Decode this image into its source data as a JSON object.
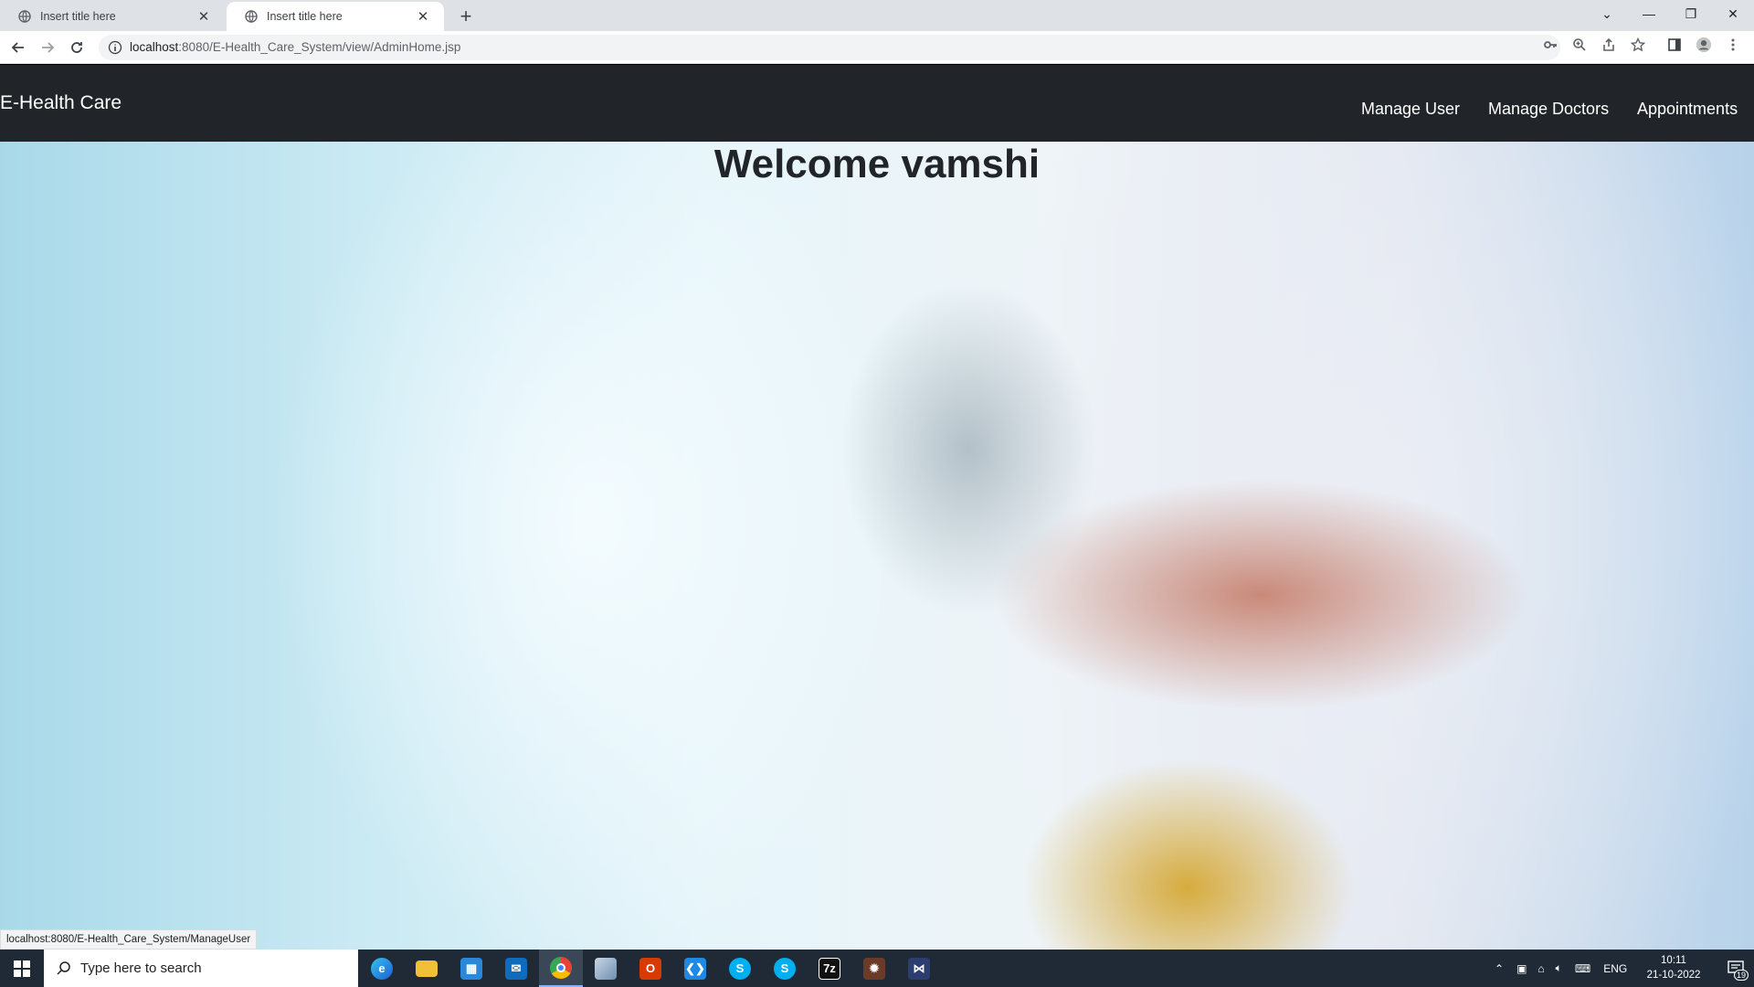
{
  "browser": {
    "tabs": [
      {
        "title": "Insert title here",
        "active": false
      },
      {
        "title": "Insert title here",
        "active": true
      }
    ],
    "url_host": "localhost",
    "url_path": ":8080/E-Health_Care_System/view/AdminHome.jsp",
    "status_url": "localhost:8080/E-Health_Care_System/ManageUser"
  },
  "navbar": {
    "brand": "E-Health Care",
    "links": [
      "Manage User",
      "Manage Doctors",
      "Appointments"
    ]
  },
  "main": {
    "welcome": "Welcome vamshi"
  },
  "taskbar": {
    "search_placeholder": "Type here to search",
    "language": "ENG",
    "time": "10:11",
    "date": "21-10-2022",
    "notification_count": "19",
    "apps": [
      "edge-icon",
      "file-explorer-icon",
      "store-icon",
      "mail-icon",
      "chrome-icon",
      "app-icon",
      "office-icon",
      "vscode-icon",
      "skype-icon",
      "skype-icon",
      "7zip-icon",
      "game-icon",
      "app-icon"
    ]
  },
  "colors": {
    "navbar_bg": "#212529",
    "taskbar_bg": "#1f2a36",
    "tabstrip_bg": "#dee1e6"
  }
}
